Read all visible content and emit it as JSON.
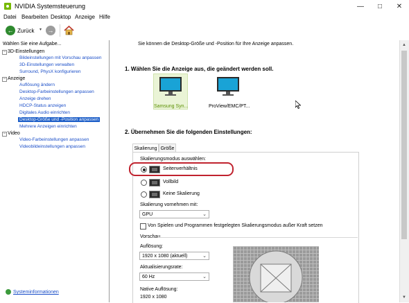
{
  "window": {
    "title": "NVIDIA Systemsteuerung"
  },
  "menu": [
    "Datei",
    "Bearbeiten",
    "Desktop",
    "Anzeige",
    "Hilfe"
  ],
  "toolbar": {
    "back_label": "Zurück"
  },
  "left_panel": {
    "header": "Wählen Sie eine Aufgabe...",
    "groups": [
      {
        "label": "3D-Einstellungen",
        "items": [
          "Bildeinstellungen mit Vorschau anpassen",
          "3D-Einstellungen verwalten",
          "Surround, PhysX konfigurieren"
        ]
      },
      {
        "label": "Anzeige",
        "items": [
          "Auflösung ändern",
          "Desktop-Farbeinstellungen anpassen",
          "Anzeige drehen",
          "HDCP-Status anzeigen",
          "Digitales Audio einrichten",
          "Desktop-Größe und -Position anpassen",
          "Mehrere Anzeigen einrichten"
        ]
      },
      {
        "label": "Video",
        "items": [
          "Video-Farbeinstellungen anpassen",
          "Videobildeinstellungen anpassen"
        ]
      }
    ],
    "selected_item": "Desktop-Größe und -Position anpassen",
    "sysinfo_link": "Systeminformationen"
  },
  "main": {
    "intro": "Sie können die Desktop-Größe und -Position für Ihre Anzeige anpassen.",
    "step1": "1. Wählen Sie die Anzeige aus, die geändert werden soll.",
    "displays": [
      {
        "label": "Samsung Syn...",
        "selected": true
      },
      {
        "label": "ProView/EMC/PT...",
        "selected": false
      }
    ],
    "step2": "2. Übernehmen Sie die folgenden Einstellungen:",
    "tabs": [
      "Skalierung",
      "Größe"
    ],
    "active_tab": "Skalierung",
    "scaling_mode_label": "Skalierungsmodus auswählen:",
    "scaling_options": [
      {
        "label": "Seitenverhältnis",
        "selected": true
      },
      {
        "label": "Vollbild",
        "selected": false
      },
      {
        "label": "Keine Skalierung",
        "selected": false
      }
    ],
    "perform_on_label": "Skalierung vornehmen mit:",
    "perform_on_value": "GPU",
    "override_checkbox": "Von Spielen und Programmen festgelegten Skalierungsmodus außer Kraft setzen",
    "override_checked": false,
    "preview_label": "Vorschau",
    "resolution_label": "Auflösung:",
    "resolution_value": "1920 x 1080 (aktuell)",
    "refresh_label": "Aktualisierungsrate:",
    "refresh_value": "60 Hz",
    "native_label": "Native Auflösung:",
    "native_value": "1920 x 1080"
  },
  "colors": {
    "accent": "#1e5fc8",
    "highlight": "#c0222e",
    "nvidia_green": "#76b900"
  }
}
